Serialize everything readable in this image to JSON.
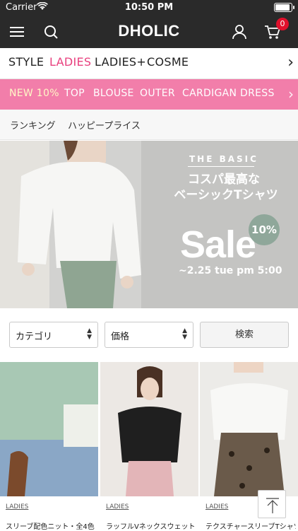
{
  "status_bar": {
    "carrier": "Carrier",
    "time": "10:50 PM"
  },
  "app_bar": {
    "logo": "DHOLIC",
    "cart_count": "0"
  },
  "categories": [
    {
      "label": "STYLE",
      "active": false
    },
    {
      "label": "LADIES",
      "active": true
    },
    {
      "label": "LADIES+",
      "active": false
    },
    {
      "label": "COSME",
      "active": false
    }
  ],
  "subcategories": [
    {
      "label": "NEW 10%",
      "active": true
    },
    {
      "label": "TOP",
      "active": false
    },
    {
      "label": "BLOUSE",
      "active": false
    },
    {
      "label": "OUTER",
      "active": false
    },
    {
      "label": "CARDIGAN",
      "active": false
    },
    {
      "label": "DRESS",
      "active": false
    }
  ],
  "quick_links": [
    "ランキング",
    "ハッピープライス"
  ],
  "banner": {
    "kicker": "THE BASIC",
    "headline_1": "コスパ最高な",
    "headline_2": "ベーシックTシャツ",
    "sale": "Sale",
    "discount": "10%",
    "until": "~2.25 tue pm 5:00"
  },
  "filters": {
    "category_select": "カテゴリ",
    "price_select": "価格",
    "search_button": "検索"
  },
  "products": [
    {
      "tag": "LADIES",
      "name": "スリーブ配色ニット・全4色"
    },
    {
      "tag": "LADIES",
      "name": "ラッフルVネックスウェット"
    },
    {
      "tag": "LADIES",
      "name": "テクスチャースリーブTシャツ"
    }
  ],
  "colors": {
    "header_bg": "#2a2a2a",
    "accent_pink": "#e8407e",
    "subnav_pink": "#f27eaa",
    "badge_red": "#e0102c",
    "sale_circle": "#8fa79a"
  }
}
